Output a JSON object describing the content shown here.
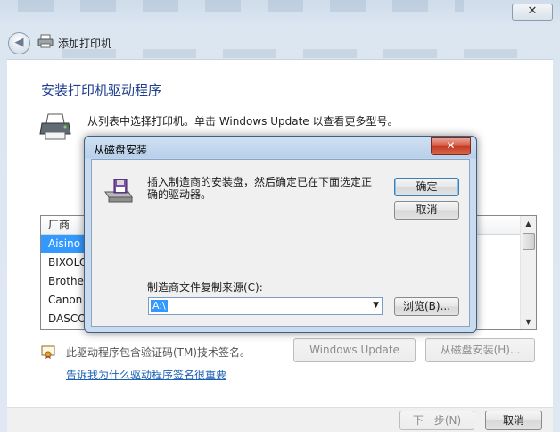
{
  "window": {
    "close_glyph": "✕",
    "nav_title": "添加打印机",
    "back_glyph": "◀"
  },
  "page": {
    "heading": "安装打印机驱动程序",
    "instruction": "从列表中选择打印机。单击 Windows Update 以查看更多型号。"
  },
  "manufacturer_list": {
    "header": "厂商",
    "items": [
      "Aisino",
      "BIXOLON",
      "Brother",
      "Canon",
      "DASCOM"
    ],
    "selected_index": 0
  },
  "cert": {
    "text": "此驱动程序包含验证码(TM)技术签名。",
    "link": "告诉我为什么驱动程序签名很重要"
  },
  "buttons": {
    "windows_update": "Windows Update",
    "have_disk": "从磁盘安装(H)...",
    "next": "下一步(N)",
    "cancel": "取消"
  },
  "dialog": {
    "title": "从磁盘安装",
    "close_glyph": "✕",
    "message": "插入制造商的安装盘，然后确定已在下面选定正确的驱动器。",
    "ok": "确定",
    "cancel": "取消",
    "source_label": "制造商文件复制来源(C):",
    "source_value": "A:\\",
    "browse": "浏览(B)..."
  },
  "colors": {
    "accent": "#3399ff",
    "heading": "#1f3d8c",
    "link": "#1a5fb4"
  }
}
